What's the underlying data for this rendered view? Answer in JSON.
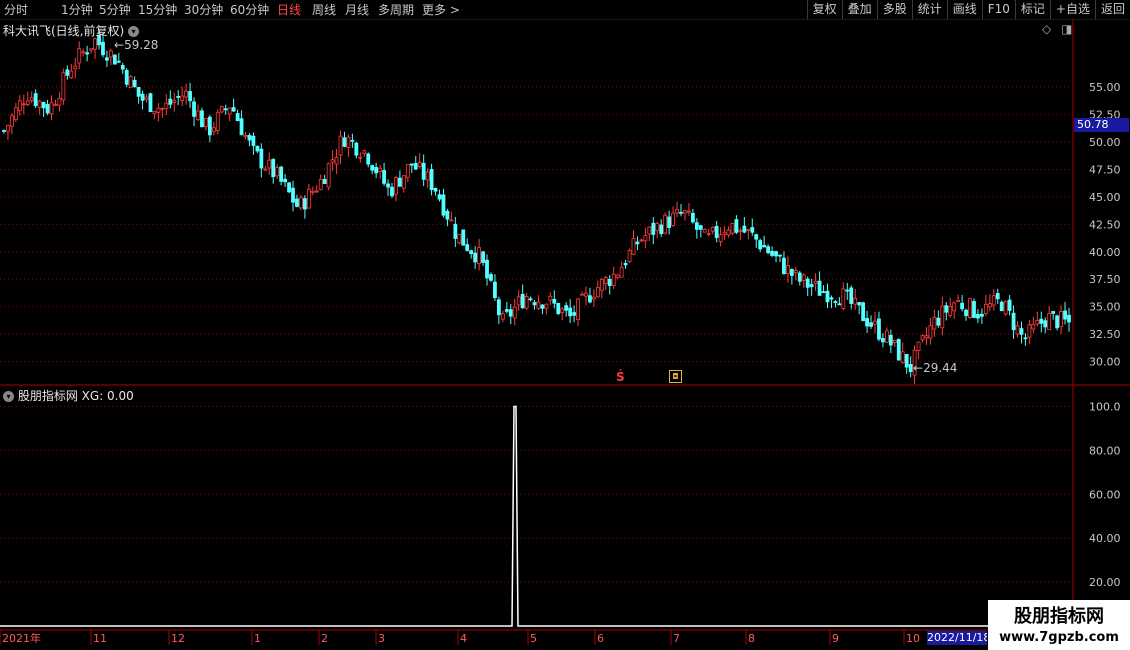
{
  "toolbar": {
    "periods": [
      "分时",
      "1分钟",
      "5分钟",
      "15分钟",
      "30分钟",
      "60分钟",
      "日线",
      "周线",
      "月线",
      "多周期",
      "更多 >"
    ],
    "active": "日线",
    "right_buttons": [
      "复权",
      "叠加",
      "多股",
      "统计",
      "画线",
      "F10",
      "标记",
      "+自选",
      "返回"
    ]
  },
  "main_pane": {
    "label": "科大讯飞(日线,前复权)",
    "high_marker": "59.28",
    "low_marker": "29.44",
    "current_price": "50.78",
    "y_ticks": [
      "55.00",
      "52.50",
      "50.00",
      "47.50",
      "45.00",
      "42.50",
      "40.00",
      "37.50",
      "35.00",
      "32.50",
      "30.00"
    ]
  },
  "indicator_pane": {
    "label": "股朋指标网",
    "value_label": "XG: 0.00",
    "y_ticks": [
      "100.0",
      "80.00",
      "60.00",
      "40.00",
      "20.00"
    ]
  },
  "time_axis": {
    "labels": [
      "2021年",
      "11",
      "12",
      "1",
      "2",
      "3",
      "4",
      "5",
      "6",
      "7",
      "8",
      "9",
      "10"
    ],
    "end_label": "2022/11/18"
  },
  "watermark": {
    "title": "股朋指标网",
    "url": "www.7gpzb.com"
  },
  "colors": {
    "up": "#ff3c3c",
    "down": "#54ffff",
    "grid": "#8a0000",
    "axis": "#b00000",
    "indicator_line": "#ffffff"
  },
  "chart_data": {
    "type": "line",
    "title": "科大讯飞(日线,前复权)",
    "price_range": [
      28,
      62
    ],
    "high": 59.28,
    "low": 29.44,
    "last": 50.78,
    "close_path": [
      {
        "x": "2021-10",
        "y": 51.0
      },
      {
        "x": "2021-10",
        "y": 54.5
      },
      {
        "x": "2021-11",
        "y": 53.0
      },
      {
        "x": "2021-11",
        "y": 57.0
      },
      {
        "x": "2021-11",
        "y": 59.28
      },
      {
        "x": "2021-11",
        "y": 57.5
      },
      {
        "x": "2021-12",
        "y": 54.0
      },
      {
        "x": "2021-12",
        "y": 53.0
      },
      {
        "x": "2021-12",
        "y": 54.5
      },
      {
        "x": "2022-01",
        "y": 51.0
      },
      {
        "x": "2022-01",
        "y": 53.5
      },
      {
        "x": "2022-01",
        "y": 49.0
      },
      {
        "x": "2022-02",
        "y": 47.0
      },
      {
        "x": "2022-02",
        "y": 44.0
      },
      {
        "x": "2022-02",
        "y": 46.5
      },
      {
        "x": "2022-03",
        "y": 50.5
      },
      {
        "x": "2022-03",
        "y": 49.0
      },
      {
        "x": "2022-03",
        "y": 45.5
      },
      {
        "x": "2022-04",
        "y": 48.0
      },
      {
        "x": "2022-04",
        "y": 46.0
      },
      {
        "x": "2022-04",
        "y": 41.5
      },
      {
        "x": "2022-04",
        "y": 39.5
      },
      {
        "x": "2022-04",
        "y": 33.5
      },
      {
        "x": "2022-05",
        "y": 36.0
      },
      {
        "x": "2022-05",
        "y": 35.5
      },
      {
        "x": "2022-05",
        "y": 34.0
      },
      {
        "x": "2022-06",
        "y": 36.5
      },
      {
        "x": "2022-06",
        "y": 38.0
      },
      {
        "x": "2022-06",
        "y": 41.0
      },
      {
        "x": "2022-06",
        "y": 42.5
      },
      {
        "x": "2022-07",
        "y": 43.5
      },
      {
        "x": "2022-07",
        "y": 41.0
      },
      {
        "x": "2022-07",
        "y": 42.5
      },
      {
        "x": "2022-08",
        "y": 41.5
      },
      {
        "x": "2022-08",
        "y": 39.5
      },
      {
        "x": "2022-08",
        "y": 37.5
      },
      {
        "x": "2022-09",
        "y": 36.5
      },
      {
        "x": "2022-09",
        "y": 36.0
      },
      {
        "x": "2022-09",
        "y": 34.0
      },
      {
        "x": "2022-09",
        "y": 32.0
      },
      {
        "x": "2022-10",
        "y": 29.44
      },
      {
        "x": "2022-10",
        "y": 33.5
      },
      {
        "x": "2022-10",
        "y": 35.5
      },
      {
        "x": "2022-10",
        "y": 34.5
      },
      {
        "x": "2022-11",
        "y": 35.5
      },
      {
        "x": "2022-11",
        "y": 32.0
      },
      {
        "x": "2022-11",
        "y": 34.0
      },
      {
        "x": "2022-11",
        "y": 33.5
      }
    ],
    "indicator": {
      "name": "XG",
      "range": [
        0,
        100
      ],
      "signal_month": "2022-04",
      "signal_value": 100
    }
  }
}
